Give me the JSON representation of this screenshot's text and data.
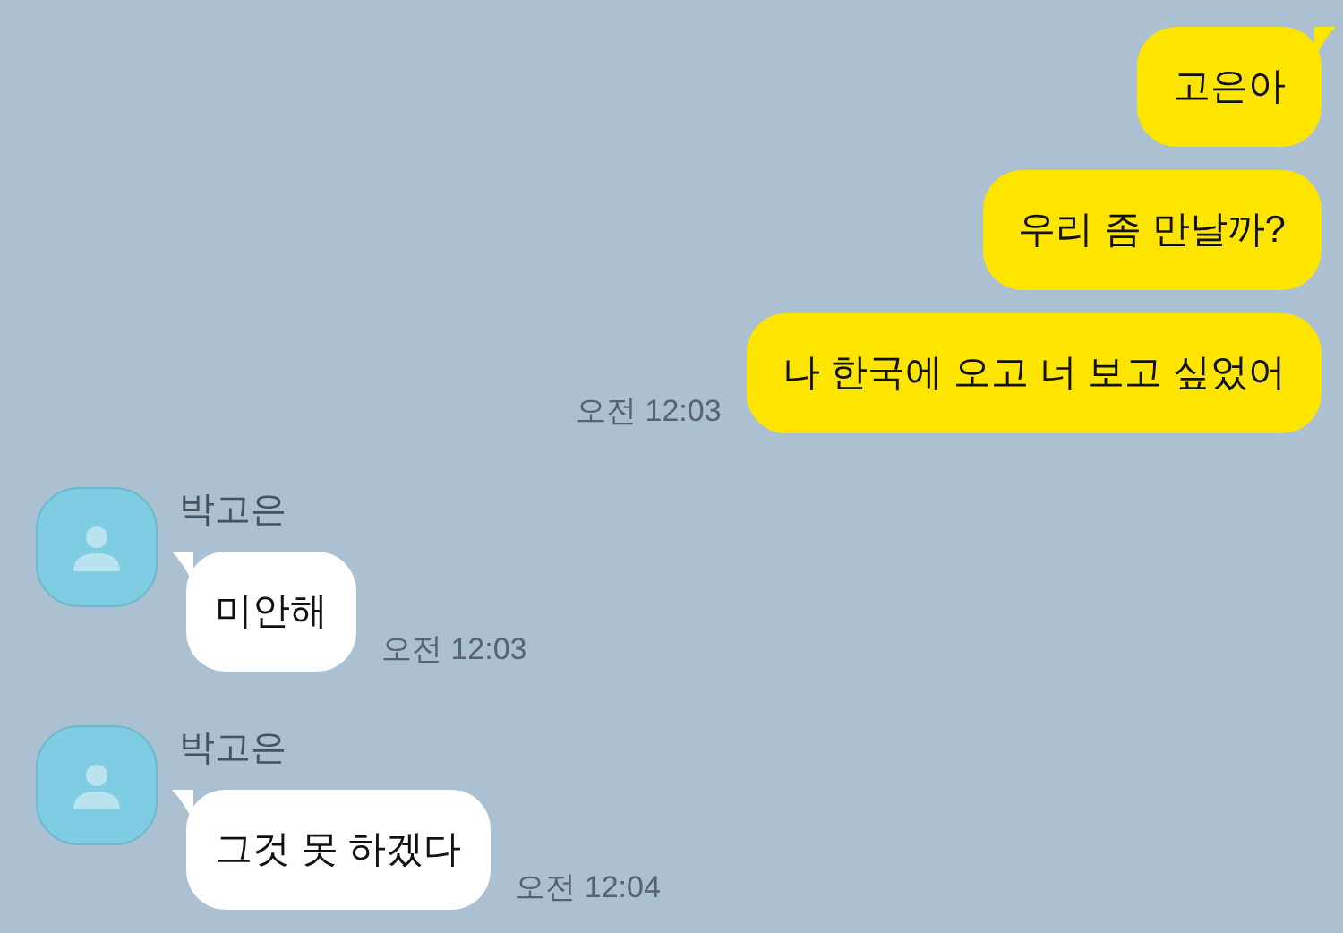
{
  "messages": [
    {
      "kind": "sent",
      "text": "고은아",
      "tail": true
    },
    {
      "kind": "sent",
      "text": "우리 좀 만날까?",
      "tail": false
    },
    {
      "kind": "sent",
      "text": "나 한국에 오고 너 보고 싶었어",
      "tail": false,
      "time": "오전 12:03"
    },
    {
      "kind": "received",
      "sender": "박고은",
      "text": "미안해",
      "tail": true,
      "time": "오전 12:03"
    },
    {
      "kind": "received",
      "sender": "박고은",
      "text": "그것 못 하겠다",
      "tail": true,
      "time": "오전 12:04"
    }
  ]
}
